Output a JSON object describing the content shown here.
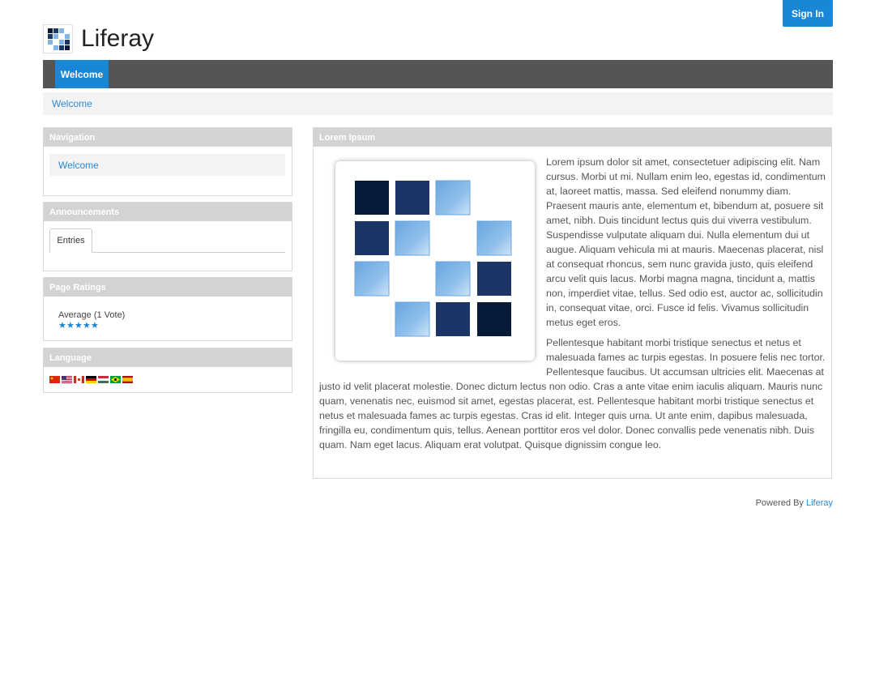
{
  "header": {
    "sign_in_label": "Sign In",
    "site_name": "Liferay"
  },
  "nav": {
    "items": [
      {
        "label": "Welcome",
        "active": true
      }
    ]
  },
  "breadcrumb": {
    "items": [
      "Welcome"
    ]
  },
  "portlets": {
    "navigation": {
      "title": "Navigation",
      "items": [
        "Welcome"
      ]
    },
    "announcements": {
      "title": "Announcements",
      "tab_label": "Entries"
    },
    "ratings": {
      "title": "Page Ratings",
      "label": "Average (1 Vote)",
      "stars_filled": 5,
      "stars_total": 5
    },
    "language": {
      "title": "Language",
      "flags": [
        "flag-icon-china",
        "flag-icon-usa",
        "flag-icon-canada",
        "flag-icon-germany",
        "flag-icon-hungary",
        "flag-icon-brazil",
        "flag-icon-spain"
      ]
    },
    "content": {
      "title": "Lorem Ipsum",
      "paragraph1": "Lorem ipsum dolor sit amet, consectetuer adipiscing elit. Nam cursus. Morbi ut mi. Nullam enim leo, egestas id, condimentum at, laoreet mattis, massa. Sed eleifend nonummy diam. Praesent mauris ante, elementum et, bibendum at, posuere sit amet, nibh. Duis tincidunt lectus quis dui viverra vestibulum. Suspendisse vulputate aliquam dui. Nulla elementum dui ut augue. Aliquam vehicula mi at mauris. Maecenas placerat, nisl at consequat rhoncus, sem nunc gravida justo, quis eleifend arcu velit quis lacus. Morbi magna magna, tincidunt a, mattis non, imperdiet vitae, tellus. Sed odio est, auctor ac, sollicitudin in, consequat vitae, orci. Fusce id felis. Vivamus sollicitudin metus eget eros.",
      "paragraph2": "Pellentesque habitant morbi tristique senectus et netus et malesuada fames ac turpis egestas. In posuere felis nec tortor. Pellentesque faucibus. Ut accumsan ultricies elit. Maecenas at justo id velit placerat molestie. Donec dictum lectus non odio. Cras a ante vitae enim iaculis aliquam. Mauris nunc quam, venenatis nec, euismod sit amet, egestas placerat, est. Pellentesque habitant morbi tristique senectus et netus et malesuada fames ac turpis egestas. Cras id elit. Integer quis urna. Ut ante enim, dapibus malesuada, fringilla eu, condimentum quis, tellus. Aenean porttitor eros vel dolor. Donec convallis pede venenatis nibh. Duis quam. Nam eget lacus. Aliquam erat volutpat. Quisque dignissim congue leo."
    }
  },
  "footer": {
    "prefix": "Powered By",
    "link": "Liferay"
  },
  "colors": {
    "accent": "#1a87d6",
    "navbar": "#555555",
    "portlet_header": "#d3d3d3",
    "dark_square": "#061a3a",
    "mid_square": "#1b3566",
    "light_square": "#7fb4e4"
  }
}
